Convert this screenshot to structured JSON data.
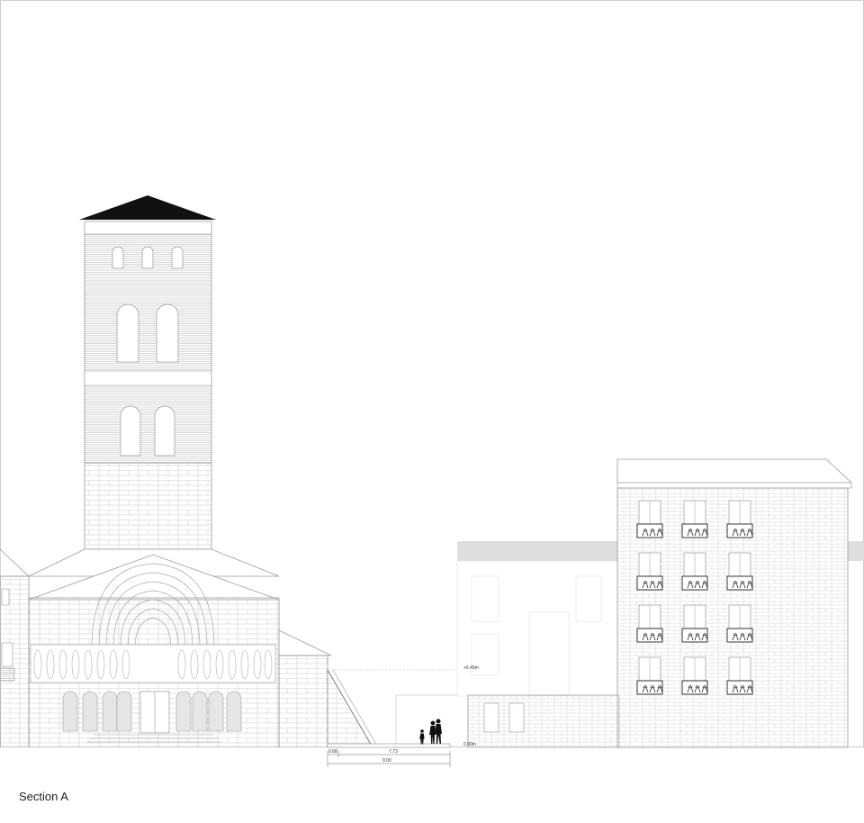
{
  "drawing": {
    "caption": "Section A",
    "levels": {
      "upper": "+5.40m",
      "ground": "0.00m"
    },
    "dimensions": {
      "left_offset": "0.68",
      "path_width": "7.73",
      "total_width": "9.00"
    }
  },
  "colors": {
    "line": "#9a9a9a",
    "line_light": "#c8c8c8",
    "roof": "#111111",
    "band": "#dedede",
    "figure": "#111111"
  }
}
